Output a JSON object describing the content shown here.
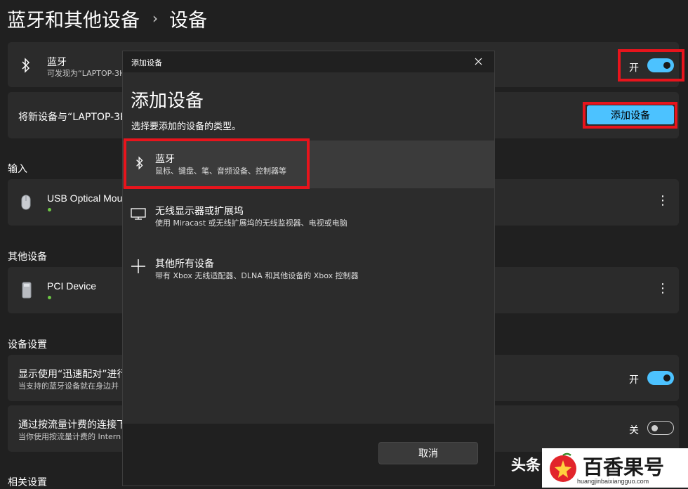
{
  "breadcrumb": {
    "parent": "蓝牙和其他设备",
    "separator": "›",
    "current": "设备"
  },
  "bluetooth_card": {
    "title": "蓝牙",
    "subtitle": "可发现为“LAPTOP-3H",
    "state": "开"
  },
  "pair_card": {
    "text": "将新设备与“LAPTOP-3HV",
    "button": "添加设备"
  },
  "sections": {
    "input": "输入",
    "other": "其他设备",
    "settings": "设备设置",
    "related": "相关设置"
  },
  "devices": {
    "mouse": {
      "name": "USB Optical Mous"
    },
    "pci": {
      "name": "PCI Device"
    }
  },
  "settings": {
    "swift_pair": {
      "title": "显示使用“迅速配对”进行",
      "subtitle": "当支持的蓝牙设备就在身边并",
      "state": "开"
    },
    "metered": {
      "title": "通过按流量计费的连接下",
      "subtitle": "当你使用按流量计费的 Intern",
      "state": "关"
    }
  },
  "dialog": {
    "window_title": "添加设备",
    "heading": "添加设备",
    "description": "选择要添加的设备的类型。",
    "options": [
      {
        "title": "蓝牙",
        "subtitle": "鼠标、键盘、笔、音频设备、控制器等"
      },
      {
        "title": "无线显示器或扩展坞",
        "subtitle": "使用 Miracast 或无线扩展坞的无线监视器、电视或电脑"
      },
      {
        "title": "其他所有设备",
        "subtitle": "带有 Xbox 无线适配器、DLNA 和其他设备的 Xbox 控制器"
      }
    ],
    "cancel": "取消"
  },
  "watermark": {
    "partial_text": "头条",
    "brand": "百香果号",
    "url": "huangjinbaixiangguo.com"
  },
  "colors": {
    "accent": "#4cc2ff",
    "highlight": "#e8141c",
    "background": "#202020",
    "card": "#2b2b2b"
  },
  "icons": [
    "bluetooth-icon",
    "mouse-icon",
    "pci-device-icon",
    "monitor-icon",
    "plus-icon",
    "close-icon",
    "more-icon"
  ]
}
